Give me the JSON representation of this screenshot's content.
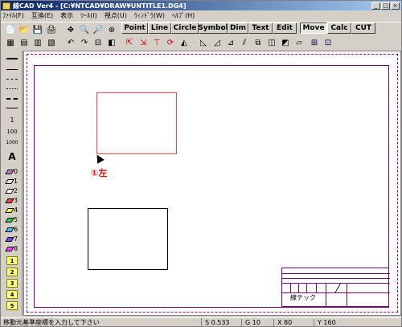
{
  "window": {
    "title": "線CAD Ver4 - [C:¥NTCAD¥DRAW¥UNTITLE1.DG4]",
    "buttons": [
      "_",
      "□",
      "×"
    ]
  },
  "menu": [
    "ﾌｧｲﾙ(F)",
    "互換(E)",
    "表示",
    "ﾂｰﾙ(I)",
    "視点(U)",
    "ｳｨﾝﾄﾞｳ(W)",
    "ﾍﾙﾌﾟ(H)"
  ],
  "tabs": [
    "Point",
    "Line",
    "Circle",
    "Symbol",
    "Dim",
    "Text",
    "Edit",
    "Move",
    "Calc",
    "CUT"
  ],
  "active_tab": "Move",
  "palette": {
    "pens": [
      "0",
      "1",
      "2",
      "3",
      "4",
      "5",
      "6",
      "7",
      "8"
    ],
    "layers": [
      "1",
      "2",
      "3",
      "4",
      "5"
    ],
    "scales": [
      "1",
      "100",
      "1000"
    ],
    "text_icon": "A"
  },
  "canvas": {
    "annotation": "①左",
    "title_block_name": "線テック"
  },
  "status": {
    "message": "移動元基準座標を入力して下さい",
    "s": "S 0.533",
    "g": "G 10",
    "x": "X 80",
    "y": "Y 160"
  },
  "colors": {
    "selected_rect": "#ff4040",
    "frame": "#800080",
    "annotation": "#e00000"
  }
}
